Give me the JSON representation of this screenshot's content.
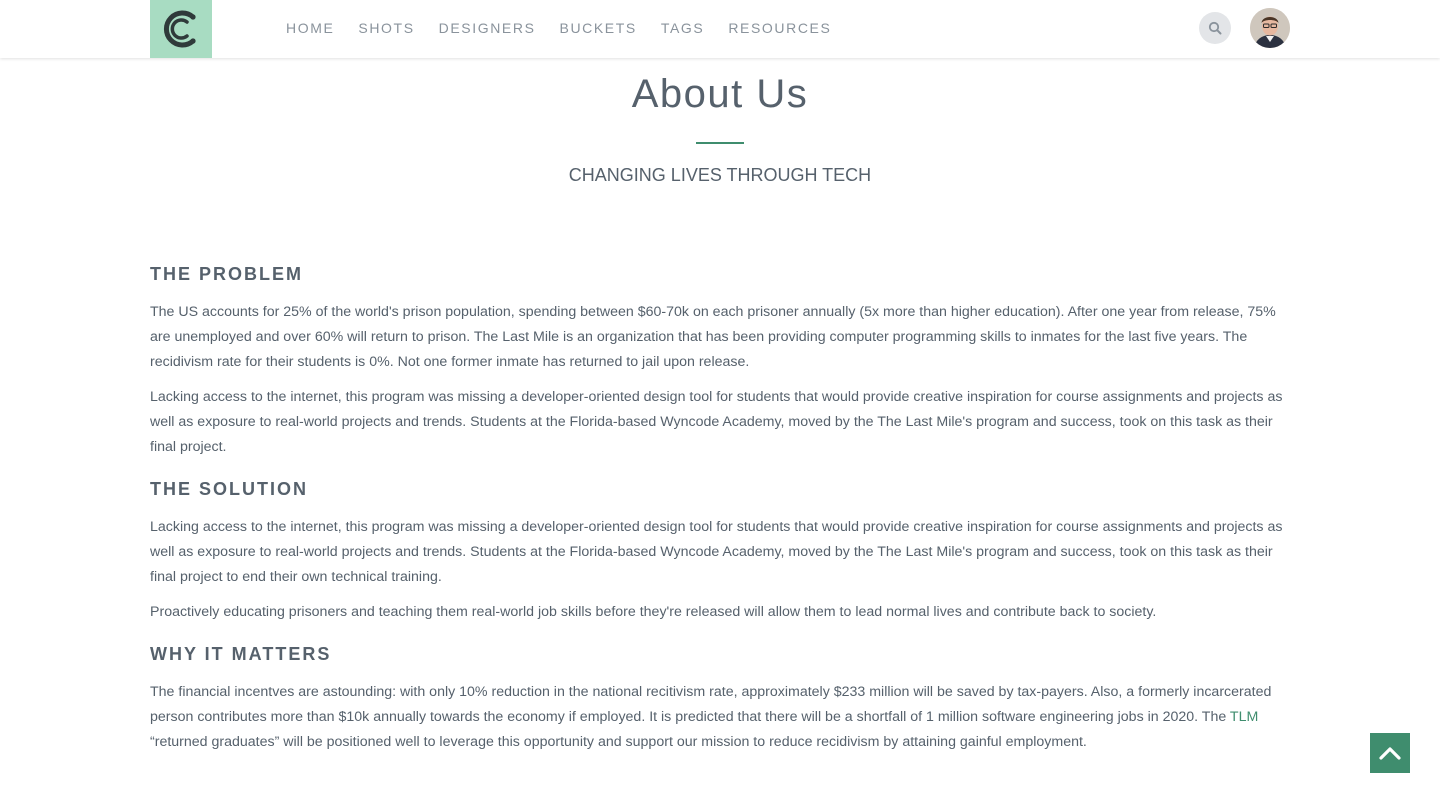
{
  "nav": {
    "logo_alt": "C logo",
    "links": [
      {
        "label": "HOME"
      },
      {
        "label": "SHOTS"
      },
      {
        "label": "DESIGNERS"
      },
      {
        "label": "BUCKETS"
      },
      {
        "label": "TAGS"
      },
      {
        "label": "RESOURCES"
      }
    ],
    "search_icon": "search-icon",
    "avatar_icon": "user-avatar"
  },
  "hero": {
    "title": "About Us",
    "subtitle": "CHANGING LIVES THROUGH TECH"
  },
  "sections": [
    {
      "heading": "THE PROBLEM",
      "paragraphs": [
        "The US accounts for 25% of the world's prison population, spending between $60-70k on each prisoner annually (5x more than higher education). After one year from release, 75% are unemployed and over 60% will return to prison. The Last Mile is an organization that has been providing computer programming skills to inmates for the last five years. The recidivism rate for their students is 0%. Not one former inmate has returned to jail upon release.",
        "Lacking access to the internet, this program was missing a developer-oriented design tool for students that would provide creative inspiration for course assignments and projects as well as exposure to real-world projects and trends. Students at the Florida-based Wyncode Academy, moved by the The Last Mile's program and success, took on this task as their final project."
      ]
    },
    {
      "heading": "THE SOLUTION",
      "paragraphs": [
        "Lacking access to the internet, this program was missing a developer-oriented design tool for students that would provide creative inspiration for course assignments and projects as well as exposure to real-world projects and trends. Students at the Florida-based Wyncode Academy, moved by the The Last Mile's program and success, took on this task as their final project to end their own technical training.",
        "Proactively educating prisoners and teaching them real-world job skills before they're released will allow them to lead normal lives and contribute back to society."
      ]
    },
    {
      "heading": "WHY IT MATTERS",
      "para_before_link": "The financial incentves are astounding: with only 10% reduction in the national recitivism rate, approximately $233 million will be saved by tax-payers. Also, a formerly incarcerated person contributes more than $10k annually towards the economy if employed. It is predicted that there will be a shortfall of 1 million software engineering jobs in 2020. The ",
      "link_text": "TLM",
      "para_after_link": " “returned graduates” will be positioned well to leverage this opportunity and support our mission to reduce recidivism by attaining gainful employment."
    }
  ],
  "back_to_top_icon": "chevron-up-icon",
  "colors": {
    "accent": "#3f8d6e",
    "logo_bg": "#a8dcc2",
    "text": "#56616c",
    "nav_text": "#8a939c"
  }
}
